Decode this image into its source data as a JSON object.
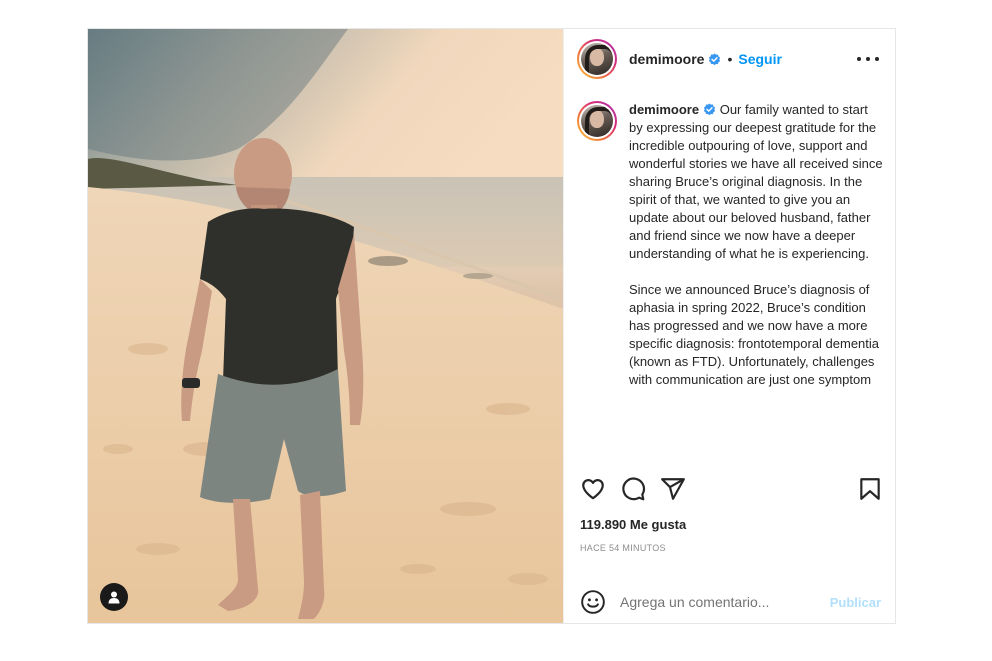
{
  "post": {
    "username": "demimoore",
    "verified": true,
    "separator": "•",
    "follow_label": "Seguir",
    "more_icon": "more-horizontal-icon",
    "caption": {
      "username": "demimoore",
      "paragraphs": [
        "Our family wanted to start by expressing our deepest gratitude for the incredible outpouring of love, support and wonderful stories we have all received since sharing Bruce’s original diagnosis. In the spirit of that, we wanted to give you an update about our beloved husband, father and friend since we now have a deeper understanding of what he is experiencing.",
        "Since we announced Bruce’s diagnosis of aphasia in spring 2022, Bruce’s condition has progressed and we now have a more specific diagnosis: frontotemporal dementia (known as FTD). Unfortunately, challenges with communication are just one symptom"
      ]
    },
    "actions": {
      "like_icon": "heart-icon",
      "comment_icon": "comment-icon",
      "share_icon": "share-icon",
      "save_icon": "bookmark-icon"
    },
    "likes_text": "119.890 Me gusta",
    "time_text": "HACE 54 MINUTOS",
    "comment": {
      "emoji_icon": "emoji-icon",
      "placeholder": "Agrega un comentario...",
      "publish_label": "Publicar"
    },
    "photo": {
      "user_tag_icon": "user-tag-icon"
    }
  },
  "colors": {
    "link_blue": "#0095f6",
    "publish_disabled": "#b2dffc",
    "verified_blue": "#3897f0",
    "text": "#262626",
    "muted": "#8e8e8e"
  }
}
